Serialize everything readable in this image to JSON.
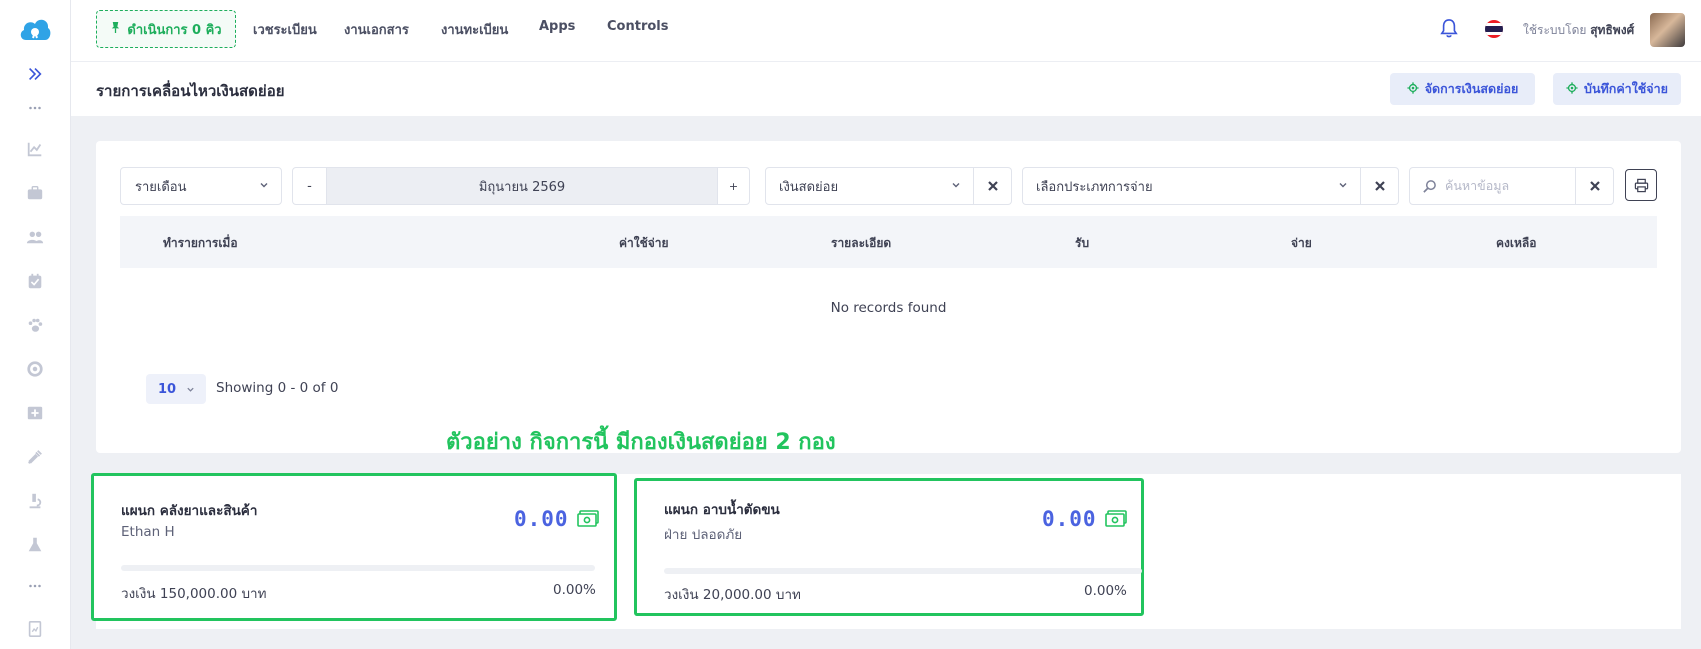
{
  "header": {
    "queue_button": "ดำเนินการ 0 คิว",
    "nav": [
      "เวชระเบียน",
      "งานเอกสาร",
      "งานทะเบียน",
      "Apps",
      "Controls"
    ],
    "user_prefix": "ใช้ระบบโดย",
    "user_name": "สุทธิพงศ์"
  },
  "subheader": {
    "title": "รายการเคลื่อนไหวเงินสดย่อย",
    "manage_button": "จัดการเงินสดย่อย",
    "record_expense_button": "บันทึกค่าใช้จ่าย"
  },
  "filters": {
    "period_select": "รายเดือน",
    "minus": "-",
    "plus": "+",
    "month_value": "มิถุนายน 2569",
    "fund_select": "เงินสดย่อย",
    "expense_type_placeholder": "เลือกประเภทการจ่าย",
    "search_placeholder": "ค้นหาข้อมูล"
  },
  "table": {
    "columns": [
      "ทำรายการเมื่อ",
      "ค่าใช้จ่าย",
      "รายละเอียด",
      "รับ",
      "จ่าย",
      "คงเหลือ"
    ],
    "empty_text": "No records found",
    "page_size": "10",
    "showing": "Showing 0 - 0 of 0"
  },
  "example_note": "ตัวอย่าง กิจการนี้ มีกองเงินสดย่อย 2 กอง",
  "funds": [
    {
      "title": "แผนก คลังยาและสินค้า",
      "subtitle": "Ethan H",
      "amount": "0.00",
      "limit": "วงเงิน 150,000.00 บาท",
      "percent_text": "0.00%",
      "percent": 0
    },
    {
      "title": "แผนก อาบน้ำตัดขน",
      "subtitle": "ฝ่าย ปลอดภัย",
      "amount": "0.00",
      "limit": "วงเงิน 20,000.00 บาท",
      "percent_text": "0.00%",
      "percent": 0
    }
  ],
  "colors": {
    "accent_green": "#22c45e",
    "accent_blue": "#3b55d9",
    "amount_blue": "#4b63e0"
  },
  "icons": {
    "sidebar": [
      "logo-icon",
      "expand-icon",
      "more-icon",
      "chart-icon",
      "briefcase-icon",
      "users-icon",
      "calendar-check-icon",
      "paw-icon",
      "lifebuoy-icon",
      "medical-box-icon",
      "syringe-icon",
      "microscope-icon",
      "flask-icon",
      "more-icon",
      "report-icon"
    ]
  }
}
